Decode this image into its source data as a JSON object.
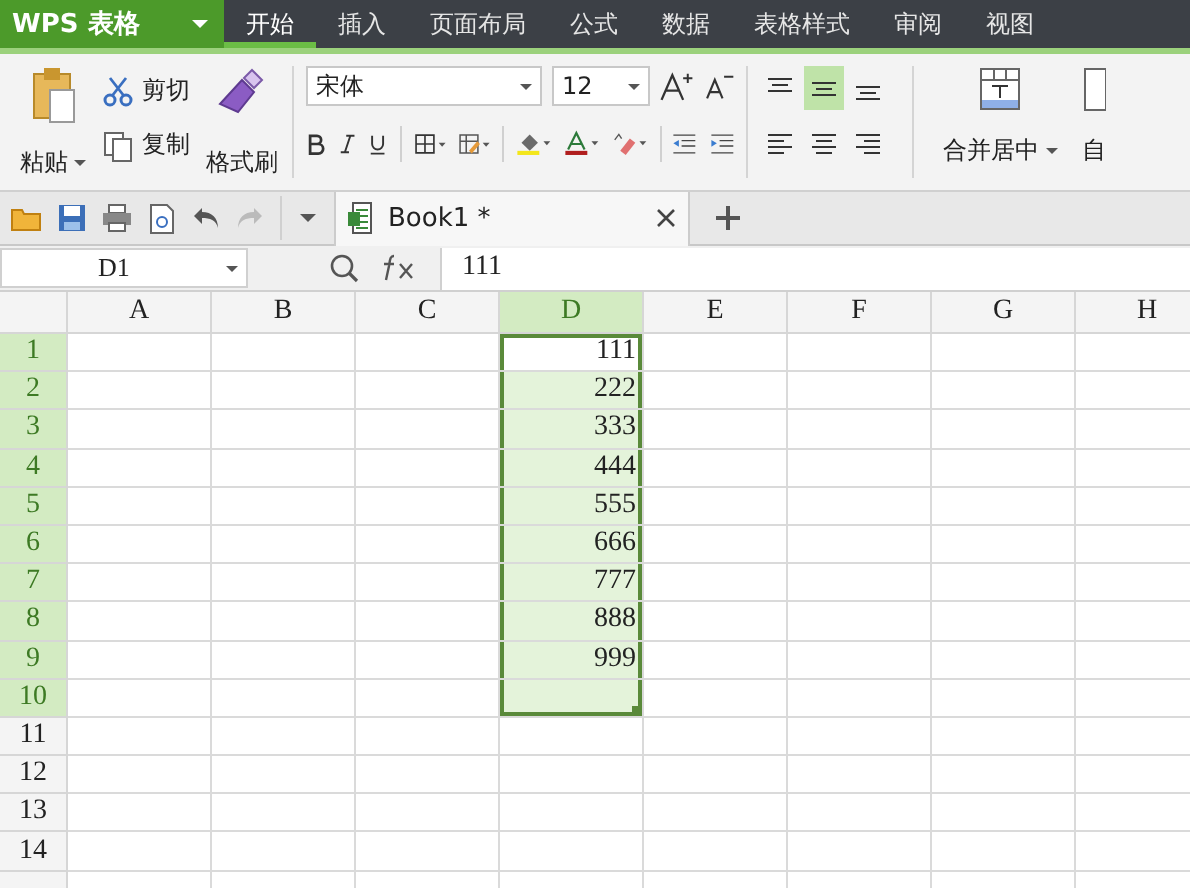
{
  "app_menu": {
    "label": "WPS 表格"
  },
  "ribbon_tabs": [
    {
      "label": "开始",
      "selected": true
    },
    {
      "label": "插入",
      "selected": false
    },
    {
      "label": "页面布局",
      "selected": false
    },
    {
      "label": "公式",
      "selected": false
    },
    {
      "label": "数据",
      "selected": false
    },
    {
      "label": "表格样式",
      "selected": false
    },
    {
      "label": "审阅",
      "selected": false
    },
    {
      "label": "视图",
      "selected": false
    }
  ],
  "clipboard": {
    "paste": "粘贴",
    "cut": "剪切",
    "copy": "复制",
    "format_painter": "格式刷"
  },
  "font": {
    "family": "宋体",
    "size": "12"
  },
  "alignment": [
    {
      "kind": "top",
      "selected": false
    },
    {
      "kind": "middle",
      "selected": true
    },
    {
      "kind": "bottom",
      "selected": false
    },
    {
      "kind": "left",
      "selected": false
    },
    {
      "kind": "center",
      "selected": false
    },
    {
      "kind": "right",
      "selected": false
    }
  ],
  "merge": {
    "label": "合并居中"
  },
  "wrap": {
    "label": "自"
  },
  "document_tabs": [
    {
      "label": "Book1 *",
      "selected": true
    }
  ],
  "formula_bar": {
    "name_box": "D1",
    "formula": "111"
  },
  "sheet": {
    "columns": [
      {
        "label": "A",
        "selected": false
      },
      {
        "label": "B",
        "selected": false
      },
      {
        "label": "C",
        "selected": false
      },
      {
        "label": "D",
        "selected": true,
        "cells": [
          {
            "text": "111",
            "active": true
          },
          {
            "text": "222",
            "active": false
          },
          {
            "text": "333",
            "active": false
          },
          {
            "text": "444",
            "active": false
          },
          {
            "text": "555",
            "active": false
          },
          {
            "text": "666",
            "active": false
          },
          {
            "text": "777",
            "active": false
          },
          {
            "text": "888",
            "active": false
          },
          {
            "text": "999",
            "active": false
          }
        ]
      },
      {
        "label": "E",
        "selected": false
      },
      {
        "label": "F",
        "selected": false
      },
      {
        "label": "G",
        "selected": false
      },
      {
        "label": "H",
        "selected": false
      }
    ],
    "rows": [
      {
        "label": "1",
        "selected": true
      },
      {
        "label": "2",
        "selected": true
      },
      {
        "label": "3",
        "selected": true
      },
      {
        "label": "4",
        "selected": true
      },
      {
        "label": "5",
        "selected": true
      },
      {
        "label": "6",
        "selected": true
      },
      {
        "label": "7",
        "selected": true
      },
      {
        "label": "8",
        "selected": true
      },
      {
        "label": "9",
        "selected": true
      },
      {
        "label": "10",
        "selected": true
      },
      {
        "label": "11",
        "selected": false
      },
      {
        "label": "12",
        "selected": false
      },
      {
        "label": "13",
        "selected": false
      },
      {
        "label": "14",
        "selected": false
      }
    ]
  }
}
